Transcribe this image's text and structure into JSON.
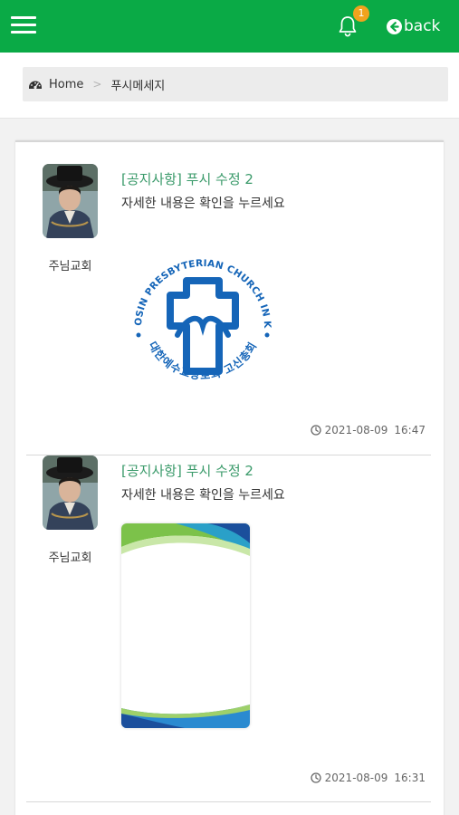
{
  "header": {
    "back_label": "back",
    "notification_count": "1",
    "color": "#0aaa46"
  },
  "breadcrumb": {
    "home": "Home",
    "separator": ">",
    "current": "푸시메세지"
  },
  "messages": [
    {
      "title": "[공지사항] 푸시 수정 2",
      "body": "자세한 내용은 확인을 누르세요",
      "sender": "주님교회",
      "date": "2021-08-09",
      "time": "16:47",
      "attachment": "church-seal-logo"
    },
    {
      "title": "[공지사항] 푸시 수정 2",
      "body": "자세한 내용은 확인을 누르세요",
      "sender": "주님교회",
      "date": "2021-08-09",
      "time": "16:31",
      "attachment": "card-image"
    }
  ],
  "logo_text": {
    "outer_top": "THE KOSIN PRESBYTERIAN CHURCH IN KOREA",
    "outer_bottom": "대한예수교장로회 고신총회"
  },
  "icons": [
    "menu-icon",
    "bell-icon",
    "back-arrow-icon",
    "dashboard-icon",
    "clock-icon"
  ]
}
